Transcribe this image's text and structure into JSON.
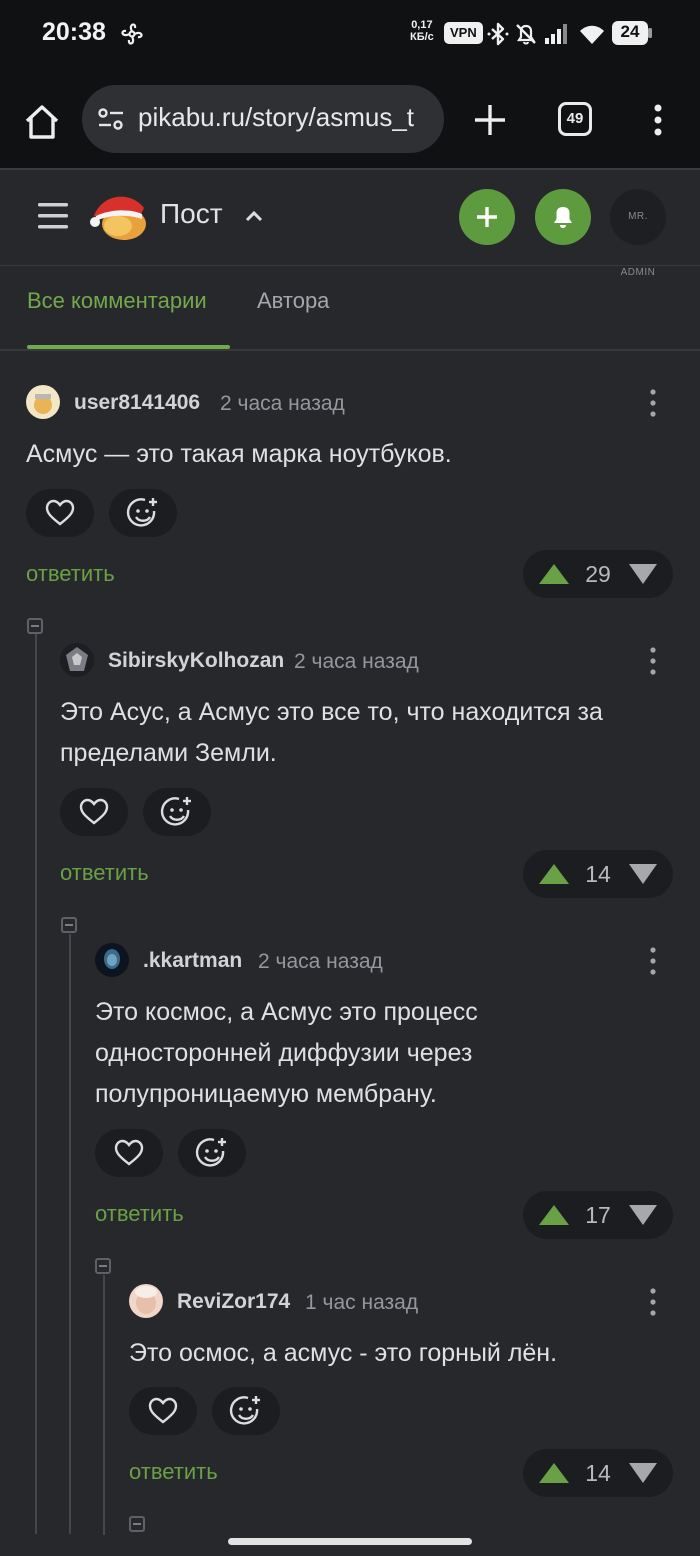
{
  "status_bar": {
    "time": "20:38",
    "net_speed_value": "0,17",
    "net_speed_unit": "КБ/с",
    "vpn": "VPN",
    "battery": "24",
    "icons": [
      "fan-icon",
      "bluetooth-icon",
      "notifications-off-icon",
      "signal-icon",
      "wifi-icon",
      "battery-icon"
    ]
  },
  "browser": {
    "url": "pikabu.ru/story/asmus_t",
    "tab_count": "49"
  },
  "header": {
    "title": "Пост",
    "avatar_text": "MR. ADMIN",
    "accent_color": "#5e9b3e"
  },
  "tabs": [
    {
      "label": "Все комментарии",
      "active": true
    },
    {
      "label": "Автора",
      "active": false
    }
  ],
  "comments": [
    {
      "user": "user8141406",
      "time": "2 часа назад",
      "text": "Асмус — это такая марка ноутбуков.",
      "reply": "ответить",
      "rating": "29"
    },
    {
      "user": "SibirskyKolhozan",
      "time": "2 часа назад",
      "text": "Это Асус, а Асмус это все то, что находится за пределами Земли.",
      "reply": "ответить",
      "rating": "14"
    },
    {
      "user": ".kkartman",
      "time": "2 часа назад",
      "text": "Это космос, а Асмус это процесс односторонней диффузии через полупроницаемую мембрану.",
      "reply": "ответить",
      "rating": "17"
    },
    {
      "user": "ReviZor174",
      "time": "1 час назад",
      "text": "Это осмос, а асмус - это горный лён.",
      "reply": "ответить",
      "rating": "14"
    }
  ]
}
